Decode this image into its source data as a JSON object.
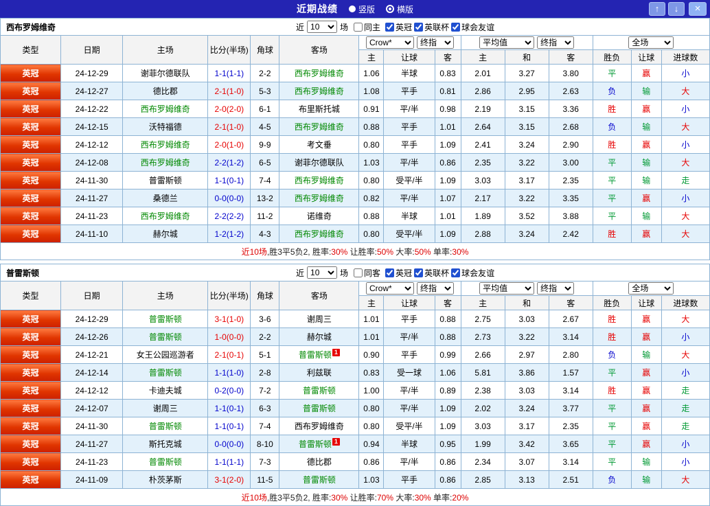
{
  "titlebar": {
    "title": "近期战绩",
    "layout_options": [
      {
        "label": "竖版",
        "selected": false
      },
      {
        "label": "横版",
        "selected": true
      }
    ],
    "icons": {
      "up": "↑",
      "down": "↓",
      "close": "×"
    }
  },
  "table_header": {
    "type": "类型",
    "date": "日期",
    "home": "主场",
    "score": "比分(半场)",
    "corner": "角球",
    "away": "客场",
    "asian_cols": [
      "主",
      "让球",
      "客"
    ],
    "euro_cols": [
      "主",
      "和",
      "客"
    ],
    "result_cols": [
      "胜负",
      "让球",
      "进球数"
    ]
  },
  "selects": {
    "bookmaker": "Crow*",
    "stage": "终指",
    "euro": "平均值",
    "euro_stage": "终指",
    "scope": "全场"
  },
  "colors": {
    "titlebar_bg": "#2424b2",
    "type_badge_top": "#ff7b40",
    "type_badge_bottom": "#cc2000",
    "grid_border": "#8db3d4",
    "row_alt_bg": "#e3f1fb",
    "focal_team": "#008800",
    "score_red": "#e60000",
    "score_blue": "#0000cc",
    "result_red": "#e60000",
    "result_green": "#009933",
    "result_blue": "#0000cc",
    "summary_red": "#dd0000",
    "summary_dark": "#222222",
    "result_map": {
      "胜": "red",
      "平": "green",
      "负": "blue",
      "赢": "red",
      "输": "green",
      "走": "green",
      "大": "red",
      "小": "blue"
    }
  },
  "sections": [
    {
      "team": "西布罗姆维奇",
      "filters": {
        "near_label": "近",
        "count": "10",
        "games_label": "场",
        "same_label": "同主",
        "same_checked": false,
        "leagues": [
          {
            "label": "英冠",
            "checked": true
          },
          {
            "label": "英联杯",
            "checked": true
          },
          {
            "label": "球会友谊",
            "checked": true
          }
        ]
      },
      "rows": [
        {
          "league": "英冠",
          "date": "24-12-29",
          "home": "谢菲尔德联队",
          "home_focal": false,
          "home_cards": 0,
          "score": "1-1(1-1)",
          "score_color": "blue",
          "corners": "2-2",
          "away": "西布罗姆维奇",
          "away_focal": true,
          "away_cards": 0,
          "ah_home": "1.06",
          "ah_line": "半球",
          "ah_away": "0.83",
          "eu_home": "2.01",
          "eu_draw": "3.27",
          "eu_away": "3.80",
          "res_wdl": "平",
          "res_ah": "赢",
          "res_ou": "小"
        },
        {
          "league": "英冠",
          "date": "24-12-27",
          "home": "德比郡",
          "home_focal": false,
          "home_cards": 0,
          "score": "2-1(1-0)",
          "score_color": "red",
          "corners": "5-3",
          "away": "西布罗姆维奇",
          "away_focal": true,
          "away_cards": 0,
          "ah_home": "1.08",
          "ah_line": "平手",
          "ah_away": "0.81",
          "eu_home": "2.86",
          "eu_draw": "2.95",
          "eu_away": "2.63",
          "res_wdl": "负",
          "res_ah": "输",
          "res_ou": "大"
        },
        {
          "league": "英冠",
          "date": "24-12-22",
          "home": "西布罗姆维奇",
          "home_focal": true,
          "home_cards": 0,
          "score": "2-0(2-0)",
          "score_color": "red",
          "corners": "6-1",
          "away": "布里斯托城",
          "away_focal": false,
          "away_cards": 0,
          "ah_home": "0.91",
          "ah_line": "平/半",
          "ah_away": "0.98",
          "eu_home": "2.19",
          "eu_draw": "3.15",
          "eu_away": "3.36",
          "res_wdl": "胜",
          "res_ah": "赢",
          "res_ou": "小"
        },
        {
          "league": "英冠",
          "date": "24-12-15",
          "home": "沃特福德",
          "home_focal": false,
          "home_cards": 0,
          "score": "2-1(1-0)",
          "score_color": "red",
          "corners": "4-5",
          "away": "西布罗姆维奇",
          "away_focal": true,
          "away_cards": 0,
          "ah_home": "0.88",
          "ah_line": "平手",
          "ah_away": "1.01",
          "eu_home": "2.64",
          "eu_draw": "3.15",
          "eu_away": "2.68",
          "res_wdl": "负",
          "res_ah": "输",
          "res_ou": "大"
        },
        {
          "league": "英冠",
          "date": "24-12-12",
          "home": "西布罗姆维奇",
          "home_focal": true,
          "home_cards": 0,
          "score": "2-0(1-0)",
          "score_color": "red",
          "corners": "9-9",
          "away": "考文垂",
          "away_focal": false,
          "away_cards": 0,
          "ah_home": "0.80",
          "ah_line": "平手",
          "ah_away": "1.09",
          "eu_home": "2.41",
          "eu_draw": "3.24",
          "eu_away": "2.90",
          "res_wdl": "胜",
          "res_ah": "赢",
          "res_ou": "小"
        },
        {
          "league": "英冠",
          "date": "24-12-08",
          "home": "西布罗姆维奇",
          "home_focal": true,
          "home_cards": 0,
          "score": "2-2(1-2)",
          "score_color": "blue",
          "corners": "6-5",
          "away": "谢菲尔德联队",
          "away_focal": false,
          "away_cards": 0,
          "ah_home": "1.03",
          "ah_line": "平/半",
          "ah_away": "0.86",
          "eu_home": "2.35",
          "eu_draw": "3.22",
          "eu_away": "3.00",
          "res_wdl": "平",
          "res_ah": "输",
          "res_ou": "大"
        },
        {
          "league": "英冠",
          "date": "24-11-30",
          "home": "普雷斯顿",
          "home_focal": false,
          "home_cards": 0,
          "score": "1-1(0-1)",
          "score_color": "blue",
          "corners": "7-4",
          "away": "西布罗姆维奇",
          "away_focal": true,
          "away_cards": 0,
          "ah_home": "0.80",
          "ah_line": "受平/半",
          "ah_away": "1.09",
          "eu_home": "3.03",
          "eu_draw": "3.17",
          "eu_away": "2.35",
          "res_wdl": "平",
          "res_ah": "输",
          "res_ou": "走"
        },
        {
          "league": "英冠",
          "date": "24-11-27",
          "home": "桑德兰",
          "home_focal": false,
          "home_cards": 0,
          "score": "0-0(0-0)",
          "score_color": "blue",
          "corners": "13-2",
          "away": "西布罗姆维奇",
          "away_focal": true,
          "away_cards": 0,
          "ah_home": "0.82",
          "ah_line": "平/半",
          "ah_away": "1.07",
          "eu_home": "2.17",
          "eu_draw": "3.22",
          "eu_away": "3.35",
          "res_wdl": "平",
          "res_ah": "赢",
          "res_ou": "小"
        },
        {
          "league": "英冠",
          "date": "24-11-23",
          "home": "西布罗姆维奇",
          "home_focal": true,
          "home_cards": 0,
          "score": "2-2(2-2)",
          "score_color": "blue",
          "corners": "11-2",
          "away": "诺维奇",
          "away_focal": false,
          "away_cards": 0,
          "ah_home": "0.88",
          "ah_line": "半球",
          "ah_away": "1.01",
          "eu_home": "1.89",
          "eu_draw": "3.52",
          "eu_away": "3.88",
          "res_wdl": "平",
          "res_ah": "输",
          "res_ou": "大"
        },
        {
          "league": "英冠",
          "date": "24-11-10",
          "home": "赫尔城",
          "home_focal": false,
          "home_cards": 0,
          "score": "1-2(1-2)",
          "score_color": "blue",
          "corners": "4-3",
          "away": "西布罗姆维奇",
          "away_focal": true,
          "away_cards": 0,
          "ah_home": "0.80",
          "ah_line": "受平/半",
          "ah_away": "1.09",
          "eu_home": "2.88",
          "eu_draw": "3.24",
          "eu_away": "2.42",
          "res_wdl": "胜",
          "res_ah": "赢",
          "res_ou": "大"
        }
      ],
      "summary": [
        {
          "text": "近10场",
          "tone": "red"
        },
        {
          "text": ",胜3平5负2, 胜率:",
          "tone": "dark"
        },
        {
          "text": "30%",
          "tone": "red"
        },
        {
          "text": " 让胜率:",
          "tone": "dark"
        },
        {
          "text": "50%",
          "tone": "red"
        },
        {
          "text": " 大率:",
          "tone": "dark"
        },
        {
          "text": "50%",
          "tone": "red"
        },
        {
          "text": " 单率:",
          "tone": "dark"
        },
        {
          "text": "30%",
          "tone": "red"
        }
      ]
    },
    {
      "team": "普雷斯顿",
      "filters": {
        "near_label": "近",
        "count": "10",
        "games_label": "场",
        "same_label": "同客",
        "same_checked": false,
        "leagues": [
          {
            "label": "英冠",
            "checked": true
          },
          {
            "label": "英联杯",
            "checked": true
          },
          {
            "label": "球会友谊",
            "checked": true
          }
        ]
      },
      "rows": [
        {
          "league": "英冠",
          "date": "24-12-29",
          "home": "普雷斯顿",
          "home_focal": true,
          "home_cards": 0,
          "score": "3-1(1-0)",
          "score_color": "red",
          "corners": "3-6",
          "away": "谢周三",
          "away_focal": false,
          "away_cards": 0,
          "ah_home": "1.01",
          "ah_line": "平手",
          "ah_away": "0.88",
          "eu_home": "2.75",
          "eu_draw": "3.03",
          "eu_away": "2.67",
          "res_wdl": "胜",
          "res_ah": "赢",
          "res_ou": "大"
        },
        {
          "league": "英冠",
          "date": "24-12-26",
          "home": "普雷斯顿",
          "home_focal": true,
          "home_cards": 0,
          "score": "1-0(0-0)",
          "score_color": "red",
          "corners": "2-2",
          "away": "赫尔城",
          "away_focal": false,
          "away_cards": 0,
          "ah_home": "1.01",
          "ah_line": "平/半",
          "ah_away": "0.88",
          "eu_home": "2.73",
          "eu_draw": "3.22",
          "eu_away": "3.14",
          "res_wdl": "胜",
          "res_ah": "赢",
          "res_ou": "小"
        },
        {
          "league": "英冠",
          "date": "24-12-21",
          "home": "女王公园巡游者",
          "home_focal": false,
          "home_cards": 0,
          "score": "2-1(0-1)",
          "score_color": "red",
          "corners": "5-1",
          "away": "普雷斯顿",
          "away_focal": true,
          "away_cards": 1,
          "ah_home": "0.90",
          "ah_line": "平手",
          "ah_away": "0.99",
          "eu_home": "2.66",
          "eu_draw": "2.97",
          "eu_away": "2.80",
          "res_wdl": "负",
          "res_ah": "输",
          "res_ou": "大"
        },
        {
          "league": "英冠",
          "date": "24-12-14",
          "home": "普雷斯顿",
          "home_focal": true,
          "home_cards": 0,
          "score": "1-1(1-0)",
          "score_color": "blue",
          "corners": "2-8",
          "away": "利兹联",
          "away_focal": false,
          "away_cards": 0,
          "ah_home": "0.83",
          "ah_line": "受一球",
          "ah_away": "1.06",
          "eu_home": "5.81",
          "eu_draw": "3.86",
          "eu_away": "1.57",
          "res_wdl": "平",
          "res_ah": "赢",
          "res_ou": "小"
        },
        {
          "league": "英冠",
          "date": "24-12-12",
          "home": "卡迪夫城",
          "home_focal": false,
          "home_cards": 0,
          "score": "0-2(0-0)",
          "score_color": "blue",
          "corners": "7-2",
          "away": "普雷斯顿",
          "away_focal": true,
          "away_cards": 0,
          "ah_home": "1.00",
          "ah_line": "平/半",
          "ah_away": "0.89",
          "eu_home": "2.38",
          "eu_draw": "3.03",
          "eu_away": "3.14",
          "res_wdl": "胜",
          "res_ah": "赢",
          "res_ou": "走"
        },
        {
          "league": "英冠",
          "date": "24-12-07",
          "home": "谢周三",
          "home_focal": false,
          "home_cards": 0,
          "score": "1-1(0-1)",
          "score_color": "blue",
          "corners": "6-3",
          "away": "普雷斯顿",
          "away_focal": true,
          "away_cards": 0,
          "ah_home": "0.80",
          "ah_line": "平/半",
          "ah_away": "1.09",
          "eu_home": "2.02",
          "eu_draw": "3.24",
          "eu_away": "3.77",
          "res_wdl": "平",
          "res_ah": "赢",
          "res_ou": "走"
        },
        {
          "league": "英冠",
          "date": "24-11-30",
          "home": "普雷斯顿",
          "home_focal": true,
          "home_cards": 0,
          "score": "1-1(0-1)",
          "score_color": "blue",
          "corners": "7-4",
          "away": "西布罗姆维奇",
          "away_focal": false,
          "away_cards": 0,
          "ah_home": "0.80",
          "ah_line": "受平/半",
          "ah_away": "1.09",
          "eu_home": "3.03",
          "eu_draw": "3.17",
          "eu_away": "2.35",
          "res_wdl": "平",
          "res_ah": "赢",
          "res_ou": "走"
        },
        {
          "league": "英冠",
          "date": "24-11-27",
          "home": "斯托克城",
          "home_focal": false,
          "home_cards": 0,
          "score": "0-0(0-0)",
          "score_color": "blue",
          "corners": "8-10",
          "away": "普雷斯顿",
          "away_focal": true,
          "away_cards": 1,
          "ah_home": "0.94",
          "ah_line": "半球",
          "ah_away": "0.95",
          "eu_home": "1.99",
          "eu_draw": "3.42",
          "eu_away": "3.65",
          "res_wdl": "平",
          "res_ah": "赢",
          "res_ou": "小"
        },
        {
          "league": "英冠",
          "date": "24-11-23",
          "home": "普雷斯顿",
          "home_focal": true,
          "home_cards": 0,
          "score": "1-1(1-1)",
          "score_color": "blue",
          "corners": "7-3",
          "away": "德比郡",
          "away_focal": false,
          "away_cards": 0,
          "ah_home": "0.86",
          "ah_line": "平/半",
          "ah_away": "0.86",
          "eu_home": "2.34",
          "eu_draw": "3.07",
          "eu_away": "3.14",
          "res_wdl": "平",
          "res_ah": "输",
          "res_ou": "小"
        },
        {
          "league": "英冠",
          "date": "24-11-09",
          "home": "朴茨茅斯",
          "home_focal": false,
          "home_cards": 0,
          "score": "3-1(2-0)",
          "score_color": "red",
          "corners": "11-5",
          "away": "普雷斯顿",
          "away_focal": true,
          "away_cards": 0,
          "ah_home": "1.03",
          "ah_line": "平手",
          "ah_away": "0.86",
          "eu_home": "2.85",
          "eu_draw": "3.13",
          "eu_away": "2.51",
          "res_wdl": "负",
          "res_ah": "输",
          "res_ou": "大"
        }
      ],
      "summary": [
        {
          "text": "近10场",
          "tone": "red"
        },
        {
          "text": ",胜3平5负2, 胜率:",
          "tone": "dark"
        },
        {
          "text": "30%",
          "tone": "red"
        },
        {
          "text": " 让胜率:",
          "tone": "dark"
        },
        {
          "text": "70%",
          "tone": "red"
        },
        {
          "text": " 大率:",
          "tone": "dark"
        },
        {
          "text": "30%",
          "tone": "red"
        },
        {
          "text": " 单率:",
          "tone": "dark"
        },
        {
          "text": "20%",
          "tone": "red"
        }
      ]
    }
  ]
}
